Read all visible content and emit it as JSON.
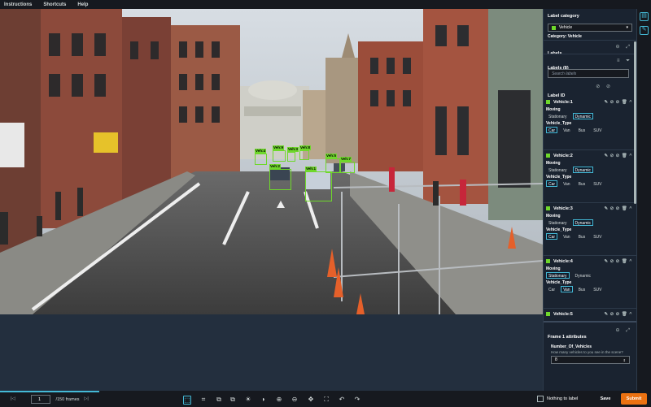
{
  "menu": [
    "Instructions",
    "Shortcuts",
    "Help"
  ],
  "boxes": [
    {
      "label": "Veh:4"
    },
    {
      "label": "Veh:9"
    },
    {
      "label": "Veh:3"
    },
    {
      "label": "Veh:8"
    },
    {
      "label": "Veh:2"
    },
    {
      "label": "Veh:1"
    },
    {
      "label": "Veh:5"
    },
    {
      "label": "Veh:7"
    }
  ],
  "panel": {
    "label_category": "Label category",
    "category_value": "Vehicle",
    "category_line": "Category: Vehicle",
    "labels": "Labels",
    "labels_count": "Labels (8)",
    "search_placeholder": "Search labels",
    "label_id": "Label ID",
    "moving_label": "Moving",
    "type_label": "Vehicle_Type",
    "moving_options": [
      "Stationary",
      "Dynamic"
    ],
    "type_options": [
      "Car",
      "Van",
      "Bus",
      "SUV"
    ],
    "vehicles": [
      {
        "name": "Vehicle:1",
        "moving": "Dynamic",
        "type": "Car"
      },
      {
        "name": "Vehicle:2",
        "moving": "Dynamic",
        "type": "Car"
      },
      {
        "name": "Vehicle:3",
        "moving": "Dynamic",
        "type": "Car"
      },
      {
        "name": "Vehicle:4",
        "moving": "Stationary",
        "type": "Van"
      }
    ],
    "vehicle5": "Vehicle:5",
    "frame_attr": "Frame 1 attributes",
    "num_label": "Number_Of_Vehicles",
    "num_question": "How many vehicles to you see in the scene?",
    "num_value": "8"
  },
  "bottom": {
    "frame_value": "1",
    "frame_total": "/150 frames",
    "nothing_label": "Nothing to label",
    "save": "Save",
    "submit": "Submit"
  },
  "colors": {
    "accent": "#44b9d6",
    "box": "#6fd82b",
    "submit": "#ec7211"
  }
}
